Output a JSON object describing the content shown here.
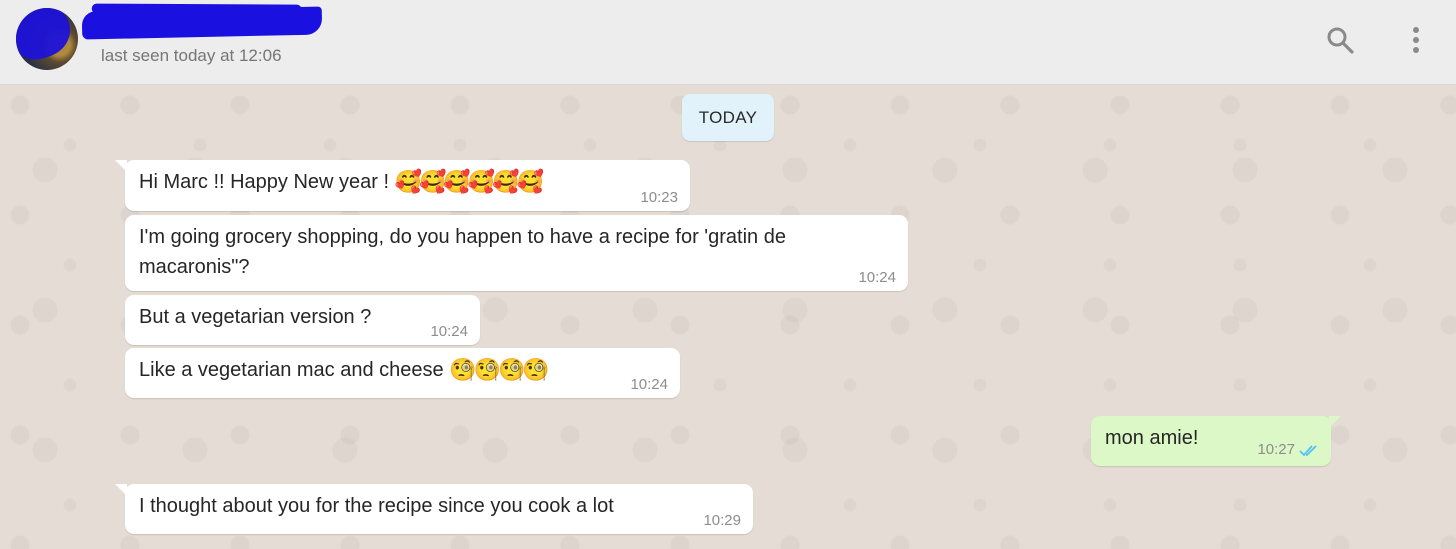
{
  "header": {
    "status": "last seen today at 12:06",
    "icons": {
      "search": "search-icon",
      "menu": "more-vertical-icon"
    }
  },
  "chat": {
    "date_label": "TODAY",
    "messages": [
      {
        "direction": "in",
        "text": "Hi Marc !! Happy New year ! ",
        "emoji": "🥰🥰🥰🥰🥰🥰",
        "time": "10:23"
      },
      {
        "direction": "in",
        "text": "I'm going grocery shopping, do you happen to have a recipe for 'gratin de macaronis\"?",
        "emoji": "",
        "time": "10:24"
      },
      {
        "direction": "in",
        "text": "But a vegetarian version ?",
        "emoji": "",
        "time": "10:24"
      },
      {
        "direction": "in",
        "text": "Like a vegetarian mac and cheese ",
        "emoji": "🧐🧐🧐🧐",
        "time": "10:24"
      },
      {
        "direction": "out",
        "text": "mon amie!",
        "emoji": "",
        "time": "10:27",
        "status_icon": "double-check-read-icon"
      },
      {
        "direction": "in",
        "text": "I thought about you for the recipe since you cook a lot",
        "emoji": "",
        "time": "10:29"
      }
    ]
  },
  "colors": {
    "header_bg": "#ededed",
    "chat_bg": "#e5ddd5",
    "incoming_bubble": "#ffffff",
    "outgoing_bubble": "#dcf8c6",
    "date_pill": "#e1f2fb",
    "read_ticks": "#4fc3f7"
  }
}
